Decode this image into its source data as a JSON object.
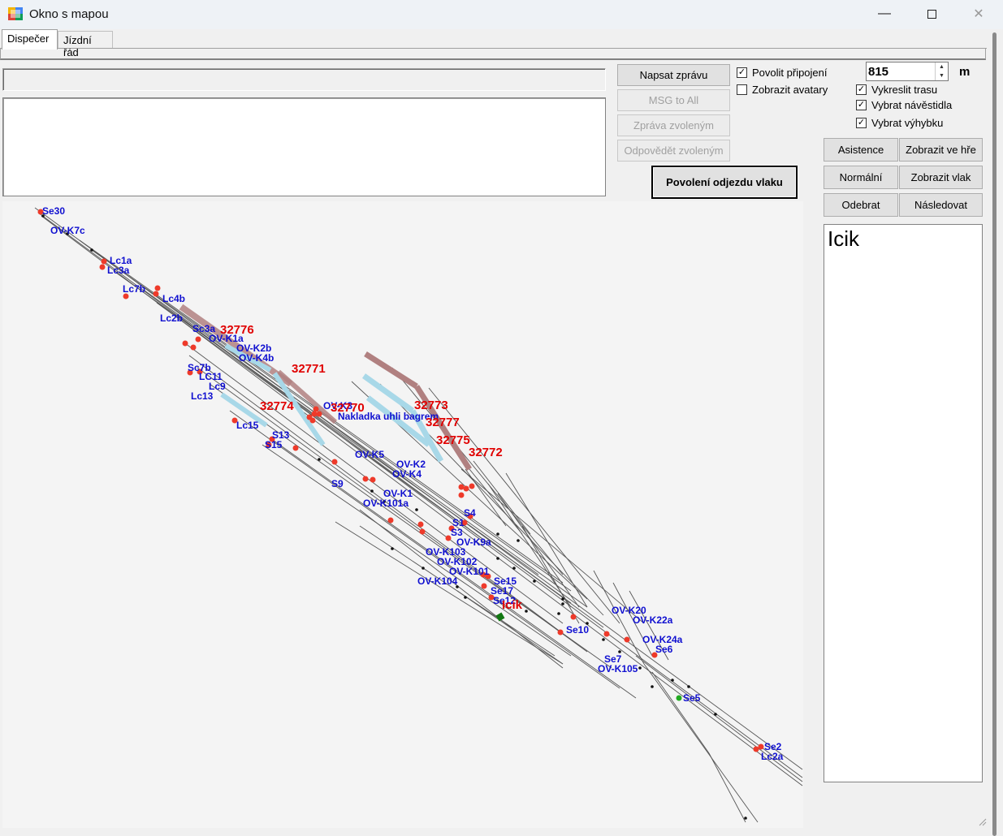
{
  "window": {
    "title": "Okno s mapou",
    "minimize_icon": "minimize-icon",
    "maximize_icon": "maximize-icon",
    "close_icon": "close-icon"
  },
  "tabs": [
    {
      "label": "Dispečer",
      "active": true
    },
    {
      "label": "Jízdní řád",
      "active": false
    }
  ],
  "status_text": "",
  "message_text": "",
  "buttons": {
    "napsat": "Napsat zprávu",
    "msg_all": "MSG to All",
    "zprava_zvolenym": "Zpráva zvoleným",
    "odpovedet": "Odpovědět zvoleným",
    "povoleni": "Povolení odjezdu vlaku",
    "asistence": "Asistence",
    "zobrazit_ve_hre": "Zobrazit ve hře",
    "normalni": "Normální",
    "zobrazit_vlak": "Zobrazit vlak",
    "odebrat": "Odebrat",
    "nasledovat": "Následovat"
  },
  "checkboxes": {
    "povolit_pripojeni": {
      "label": "Povolit připojení",
      "checked": true
    },
    "zobrazit_avatary": {
      "label": "Zobrazit avatary",
      "checked": false
    },
    "vykreslit_trasu": {
      "label": "Vykreslit trasu",
      "checked": true
    },
    "vybrat_navestidla": {
      "label": "Vybrat návěstidla",
      "checked": true
    },
    "vybrat_vyhybku": {
      "label": "Vybrat výhybku",
      "checked": true
    }
  },
  "distance": {
    "value": "815",
    "unit": "m"
  },
  "player_list": [
    "Icik"
  ],
  "colors": {
    "signal_red": "#ee3a2a",
    "label_blue": "#1010d0",
    "train_red": "#e00000",
    "track": "#555555",
    "occupied_brown": "#b08080",
    "route_blue": "#a8d8e8",
    "player_green": "#117711"
  },
  "map": {
    "signal_labels": [
      "Se30",
      "OV-K7c",
      "Lc1a",
      "Lc3a",
      "Lc7b",
      "Lc4b",
      "Lc2b",
      "Sc3a",
      "OV-K1a",
      "OV-K2b",
      "OV-K4b",
      "Sc7b",
      "LC11",
      "Lc9",
      "Lc13",
      "Lc15",
      "S13",
      "S15",
      "OV-K3",
      "Nakladka uhli bagrem",
      "OV-K5",
      "OV-K2",
      "OV-K4",
      "S9",
      "OV-K1",
      "OV-K101a",
      "S4",
      "S1",
      "S3",
      "OV-K9a",
      "OV-K103",
      "OV-K102",
      "OV-K101",
      "OV-K104",
      "Se15",
      "Se17",
      "Se12",
      "OV-K20",
      "OV-K22a",
      "Se10",
      "OV-K24a",
      "Se6",
      "Se7",
      "OV-K105",
      "Se5",
      "Se2",
      "Lc2a"
    ],
    "train_numbers": [
      "32776",
      "32771",
      "32774",
      "32770",
      "32773",
      "32777",
      "32775",
      "32772"
    ],
    "player_marker": "Icik"
  }
}
